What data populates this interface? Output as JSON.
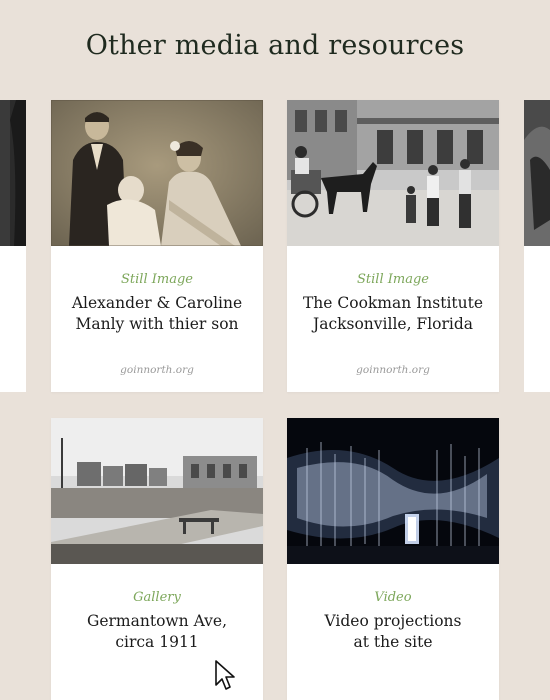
{
  "page": {
    "title": "Other media and resources",
    "background": "#e9e1d9",
    "accent": "#7da75b"
  },
  "cards": [
    {
      "type": "Still Image",
      "title_lines": [
        "Alexander & Caroline",
        "Manly with thier son"
      ],
      "source": "goinnorth.org",
      "thumbnail": "sepia-family-portrait"
    },
    {
      "type": "Still Image",
      "title_lines": [
        "The Cookman Institute",
        "Jacksonville, Florida"
      ],
      "source": "goinnorth.org",
      "thumbnail": "street-scene-horse-cart"
    },
    {
      "type": "Gallery",
      "title_lines": [
        "Germantown Ave,",
        "circa 1911"
      ],
      "thumbnail": "old-street-photo"
    },
    {
      "type": "Video",
      "title_lines": [
        "Video projections",
        "at the site"
      ],
      "thumbnail": "night-light-projection"
    }
  ],
  "cursor": "arrow-pointer-icon"
}
